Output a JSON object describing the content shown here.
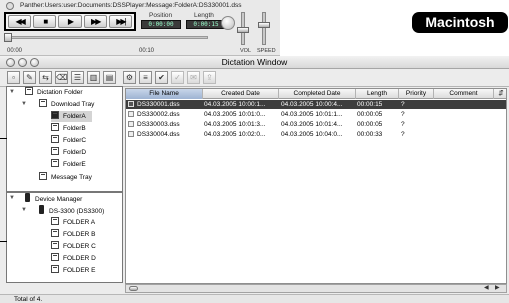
{
  "player": {
    "file_path": "Panther:Users:user:Documents:DSSPlayer:Message:FolderA:DS330001.dss",
    "controls": [
      "◀◀",
      "■",
      "▶",
      "▶▶",
      "▶▶|"
    ],
    "position_label": "Position",
    "position_value": "0:00:00",
    "length_label": "Length",
    "length_value": "0:00:15",
    "tick_start": "00:00",
    "tick_mid": "00:10",
    "vol_label": "VOL",
    "speed_label": "SPEED"
  },
  "badge": {
    "text": "Macintosh"
  },
  "window": {
    "title": "Dictation Window",
    "toolbar_icons": [
      "new-icon",
      "record-icon",
      "move-icon",
      "delete-icon",
      "list-icon",
      "split-icon",
      "join-icon",
      "properties-icon",
      "edit-icon",
      "check-icon",
      "verify-icon",
      "mail-icon",
      "ftp-icon"
    ]
  },
  "tree": {
    "top": [
      {
        "label": "Dictation Folder",
        "level": 0,
        "icon": "folder-icon",
        "toggle": true
      },
      {
        "label": "Download Tray",
        "level": 1,
        "icon": "folder-icon",
        "toggle": true
      },
      {
        "label": "FolderA",
        "level": 2,
        "icon": "folder-dark-icon",
        "selected": true
      },
      {
        "label": "FolderB",
        "level": 2,
        "icon": "folder-icon"
      },
      {
        "label": "FolderC",
        "level": 2,
        "icon": "folder-icon"
      },
      {
        "label": "FolderD",
        "level": 2,
        "icon": "folder-icon"
      },
      {
        "label": "FolderE",
        "level": 2,
        "icon": "folder-icon"
      },
      {
        "label": "Message Tray",
        "level": 1,
        "icon": "folder-icon"
      }
    ],
    "bottom": [
      {
        "label": "Device Manager",
        "level": 0,
        "icon": "device-icon",
        "toggle": true
      },
      {
        "label": "DS-3300 (DS3300)",
        "level": 1,
        "icon": "device-icon",
        "toggle": true
      },
      {
        "label": "FOLDER A",
        "level": 2,
        "icon": "folder-icon"
      },
      {
        "label": "FOLDER B",
        "level": 2,
        "icon": "folder-icon"
      },
      {
        "label": "FOLDER C",
        "level": 2,
        "icon": "folder-icon"
      },
      {
        "label": "FOLDER D",
        "level": 2,
        "icon": "folder-icon"
      },
      {
        "label": "FOLDER E",
        "level": 2,
        "icon": "folder-icon"
      }
    ]
  },
  "list": {
    "headers": [
      "File Name",
      "Created Date",
      "Completed Date",
      "Length",
      "Priority",
      "Comment"
    ],
    "rows": [
      [
        "DS330001.dss",
        "04.03.2005  10:00:1...",
        "04.03.2005  10:00:4...",
        "00:00:15",
        "?",
        ""
      ],
      [
        "DS330002.dss",
        "04.03.2005  10:01:0...",
        "04.03.2005  10:01:1...",
        "00:00:05",
        "?",
        ""
      ],
      [
        "DS330003.dss",
        "04.03.2005  10:01:3...",
        "04.03.2005  10:01:4...",
        "00:00:05",
        "?",
        ""
      ],
      [
        "DS330004.dss",
        "04.03.2005  10:02:0...",
        "04.03.2005  10:04:0...",
        "00:00:33",
        "?",
        ""
      ]
    ]
  },
  "status": {
    "text": "Total of 4."
  }
}
